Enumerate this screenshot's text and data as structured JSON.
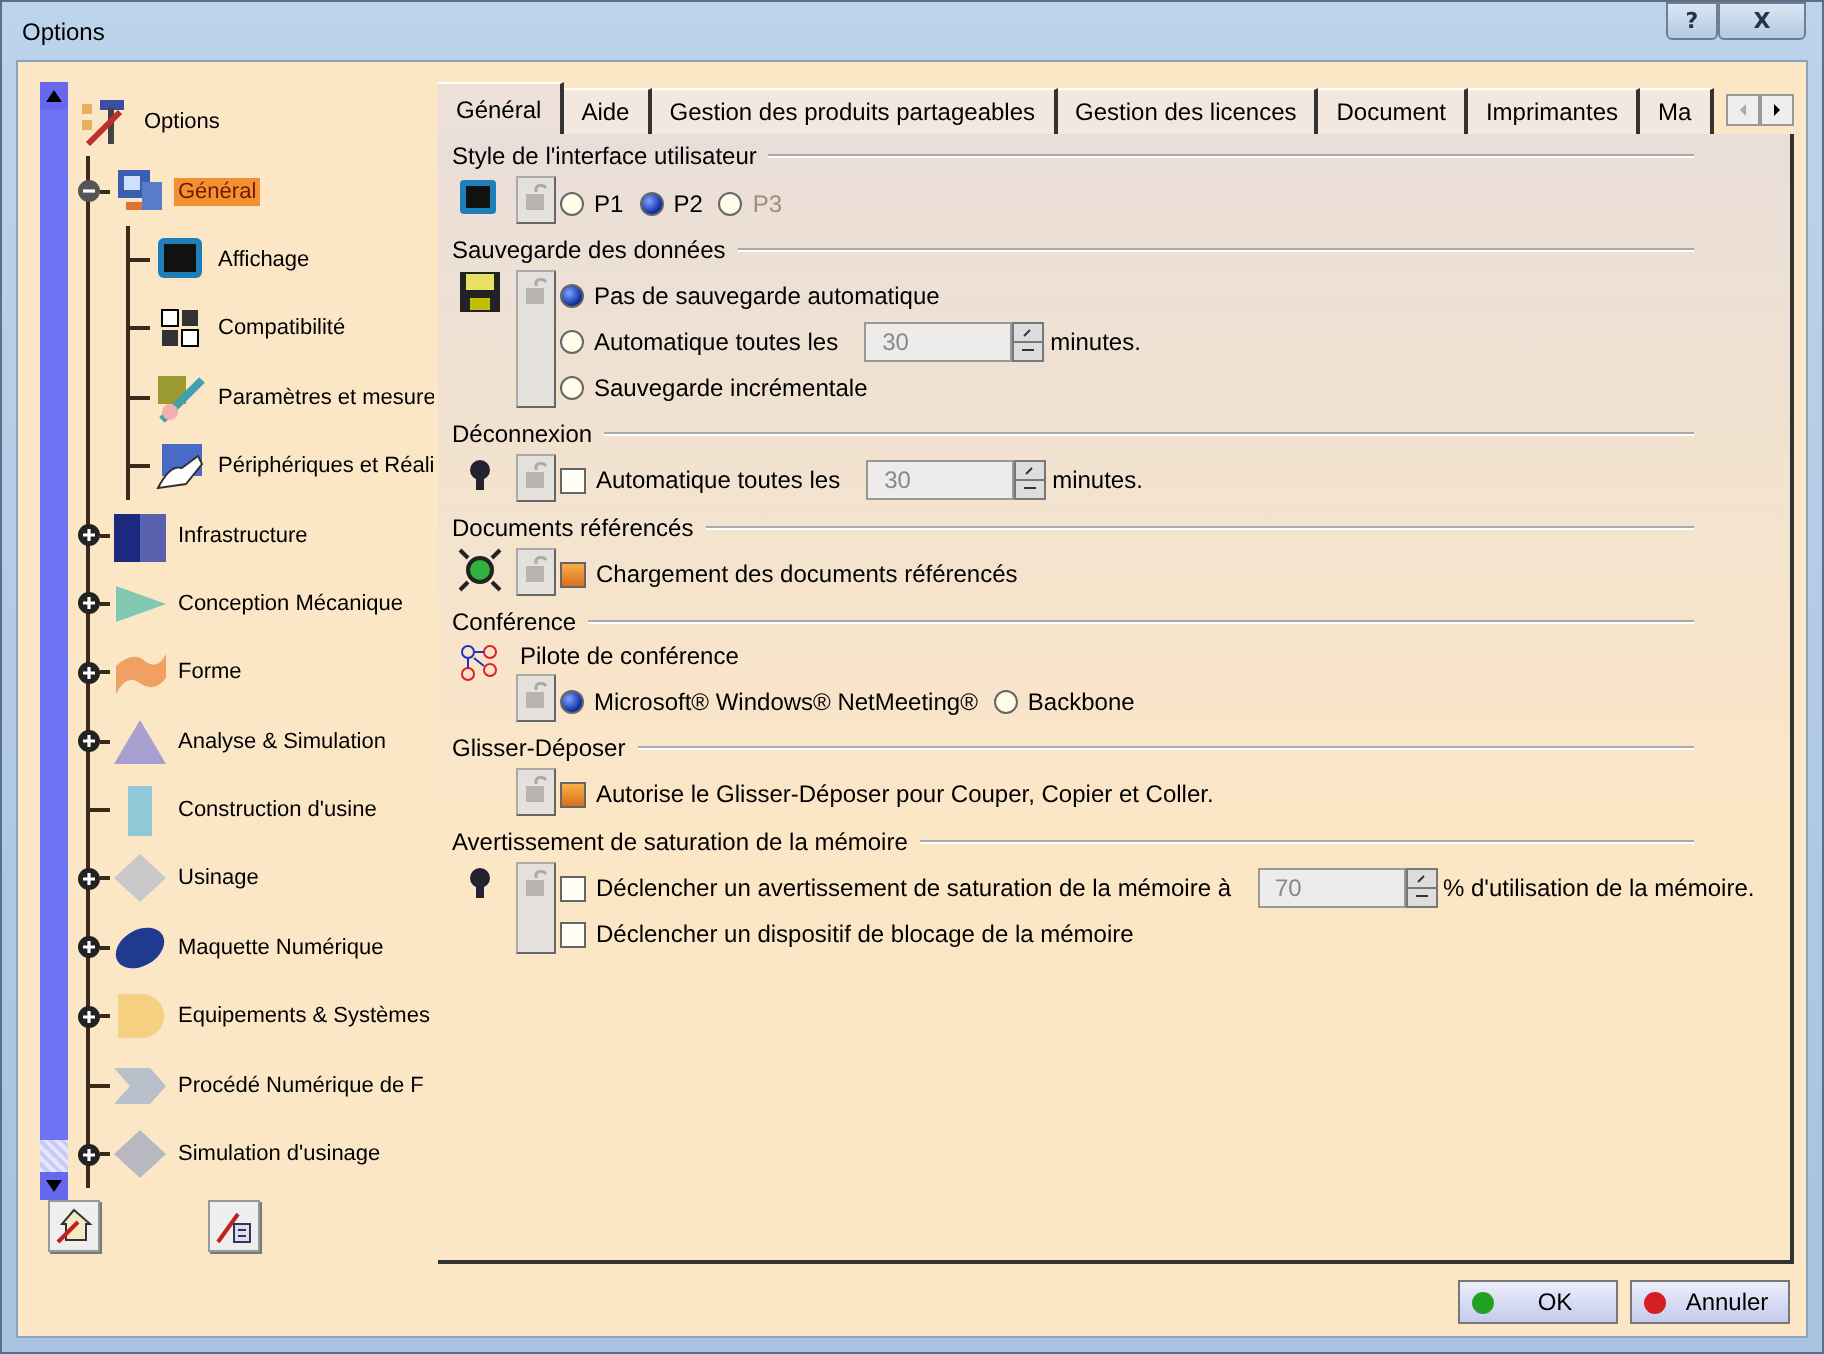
{
  "window": {
    "title": "Options",
    "controls": [
      "?",
      "X"
    ]
  },
  "tree": {
    "label": "Options",
    "selected": false,
    "children": [
      {
        "label": "Général",
        "expanded": true,
        "selected": true,
        "children": [
          {
            "label": "Affichage",
            "selected": false
          },
          {
            "label": "Compatibilité",
            "selected": false
          },
          {
            "label": "Paramètres et mesure",
            "selected": false
          },
          {
            "label": "Périphériques et Réali",
            "selected": false
          }
        ]
      },
      {
        "label": "Infrastructure",
        "expanded": false,
        "selected": false
      },
      {
        "label": "Conception Mécanique",
        "expanded": false,
        "selected": false
      },
      {
        "label": "Forme",
        "expanded": false,
        "selected": false
      },
      {
        "label": "Analyse & Simulation",
        "expanded": false,
        "selected": false
      },
      {
        "label": "Construction d'usine",
        "selected": false
      },
      {
        "label": "Usinage",
        "expanded": false,
        "selected": false
      },
      {
        "label": "Maquette Numérique",
        "expanded": false,
        "selected": false
      },
      {
        "label": "Equipements & Systèmes",
        "expanded": false,
        "selected": false
      },
      {
        "label": "Procédé Numérique de F",
        "selected": false
      },
      {
        "label": "Simulation d'usinage",
        "expanded": false,
        "selected": false
      }
    ]
  },
  "tabs": [
    {
      "label": "Général",
      "selected": true
    },
    {
      "label": "Aide",
      "selected": false
    },
    {
      "label": "Gestion des produits partageables",
      "selected": false
    },
    {
      "label": "Gestion des licences",
      "selected": false
    },
    {
      "label": "Document",
      "selected": false
    },
    {
      "label": "Imprimantes",
      "selected": false
    },
    {
      "label": "Ma",
      "selected": false
    }
  ],
  "sections": [
    {
      "title": "Style de l'interface utilisateur",
      "inline": true,
      "options": [
        {
          "kind": "radio",
          "label": "P1",
          "selected": false,
          "disabled": false
        },
        {
          "kind": "radio",
          "label": "P2",
          "selected": true,
          "disabled": false
        },
        {
          "kind": "radio",
          "label": "P3",
          "selected": false,
          "disabled": true
        }
      ]
    },
    {
      "title": "Sauvegarde des données",
      "inline": false,
      "options": [
        {
          "kind": "radio",
          "label": "Pas de sauvegarde automatique",
          "selected": true,
          "disabled": false
        },
        {
          "kind": "radio",
          "label": "Automatique toutes les",
          "selected": false,
          "disabled": false,
          "spin": {
            "value": "30",
            "suffix": "minutes."
          }
        },
        {
          "kind": "radio",
          "label": "Sauvegarde incrémentale",
          "selected": false,
          "disabled": false
        }
      ]
    },
    {
      "title": "Déconnexion",
      "inline": false,
      "options": [
        {
          "kind": "checkbox",
          "label": "Automatique toutes les",
          "checked": false,
          "spin": {
            "value": "30",
            "suffix": "minutes."
          }
        }
      ]
    },
    {
      "title": "Documents référencés",
      "inline": false,
      "options": [
        {
          "kind": "checkbox",
          "label": "Chargement des documents référencés",
          "checked": true
        }
      ]
    },
    {
      "title": "Conférence",
      "subtitle": "Pilote de conférence",
      "inline": true,
      "options": [
        {
          "kind": "radio",
          "label": "Microsoft® Windows® NetMeeting®",
          "selected": true,
          "disabled": false
        },
        {
          "kind": "radio",
          "label": "Backbone",
          "selected": false,
          "disabled": false
        }
      ]
    },
    {
      "title": "Glisser-Déposer",
      "inline": false,
      "options": [
        {
          "kind": "checkbox",
          "label": "Autorise le Glisser-Déposer pour Couper, Copier et Coller.",
          "checked": true
        }
      ]
    },
    {
      "title": "Avertissement de saturation de la mémoire",
      "inline": false,
      "options": [
        {
          "kind": "checkbox",
          "label": "Déclencher un avertissement de saturation de la mémoire à",
          "checked": false,
          "spin": {
            "value": "70",
            "suffix": "% d'utilisation de la mémoire."
          }
        },
        {
          "kind": "checkbox",
          "label": "Déclencher un dispositif de blocage de la mémoire",
          "checked": false
        }
      ]
    }
  ],
  "buttons": [
    {
      "label": "OK",
      "color": "#22a022"
    },
    {
      "label": "Annuler",
      "color": "#d42020"
    }
  ]
}
